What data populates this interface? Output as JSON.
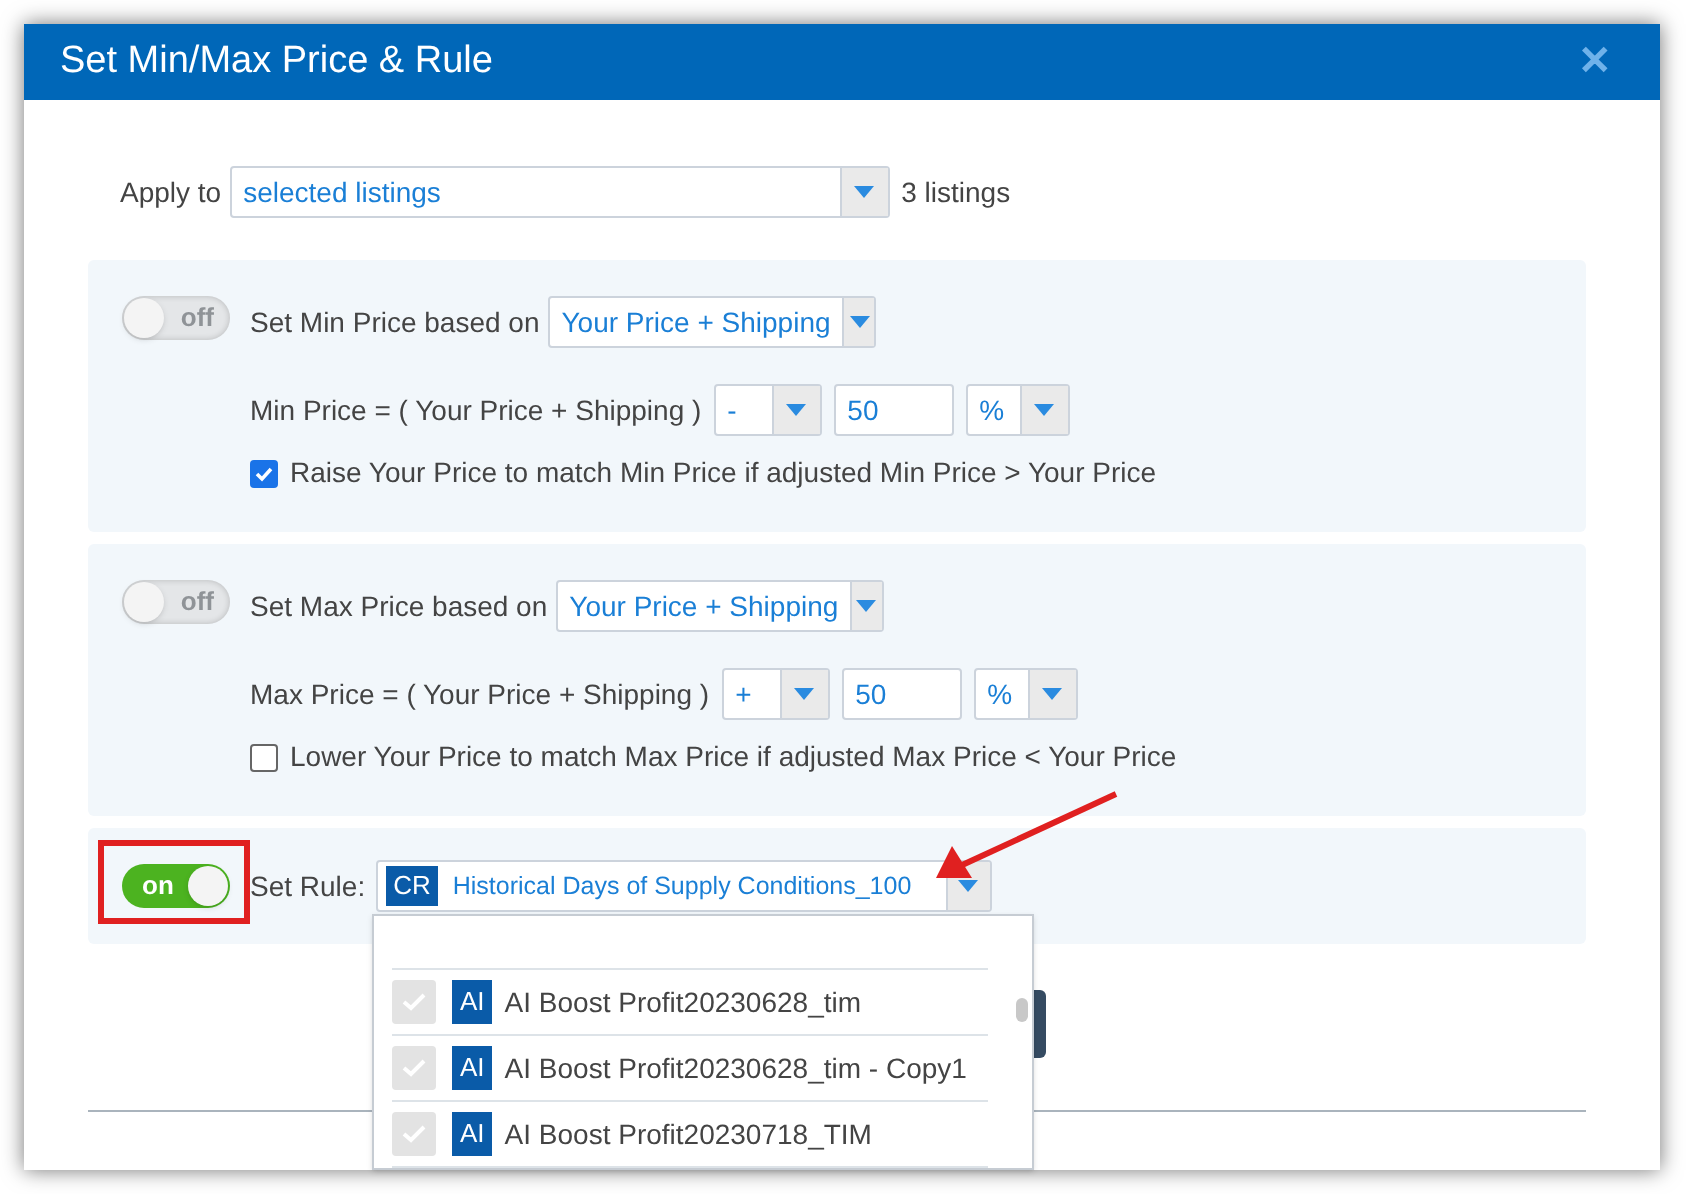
{
  "window": {
    "title": "Set Min/Max Price & Rule",
    "close": "✕"
  },
  "apply_to": {
    "label": "Apply to",
    "value": "selected listings",
    "count": "3 listings"
  },
  "min_section": {
    "on": false,
    "toggle_text": "off",
    "label": "Set Min Price based on",
    "basis": "Your Price + Shipping",
    "formula": "Min Price = ( Your Price + Shipping )",
    "operator": "-",
    "amount": "50",
    "unit": "%",
    "check_label": "Raise Your Price to match Min Price if adjusted Min Price > Your Price",
    "checked": true
  },
  "max_section": {
    "on": false,
    "toggle_text": "off",
    "label": "Set Max Price based on",
    "basis": "Your Price + Shipping",
    "formula": "Max Price = ( Your Price + Shipping )",
    "operator": "+",
    "amount": "50",
    "unit": "%",
    "check_label": "Lower Your Price to match Max Price if adjusted Max Price < Your Price",
    "checked": false
  },
  "rule_section": {
    "on": true,
    "toggle_text": "on",
    "label": "Set Rule:",
    "badge": "CR",
    "value": "Historical Days of Supply Conditions_100",
    "options": [
      {
        "badge": "AI",
        "label": "AI Boost Profit20230628_tim",
        "checked": false
      },
      {
        "badge": "AI",
        "label": "AI Boost Profit20230628_tim - Copy1",
        "checked": false
      },
      {
        "badge": "AI",
        "label": "AI Boost Profit20230718_TIM",
        "checked": false
      }
    ]
  }
}
